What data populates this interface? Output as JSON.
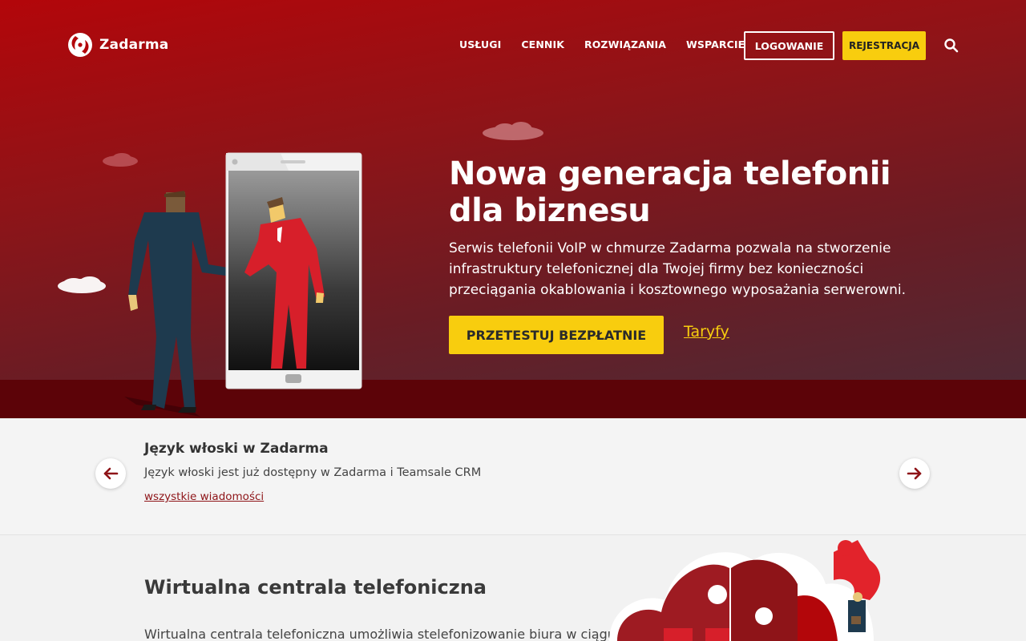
{
  "brand": {
    "name": "Zadarma"
  },
  "nav": {
    "items": [
      "USŁUGI",
      "CENNIK",
      "ROZWIĄZANIA",
      "WSPARCIE"
    ],
    "login_label": "LOGOWANIE",
    "register_label": "REJESTRACJA"
  },
  "hero": {
    "title": "Nowa generacja telefonii dla biznesu",
    "description": "Serwis telefonii VoIP w chmurze Zadarma pozwala na stworzenie infrastruktury telefonicznej dla Twojej firmy bez konieczności przeciągania okablowania i kosztownego wyposażania serwerowni.",
    "cta_label": "PRZETESTUJ BEZPŁATNIE",
    "secondary_link": "Taryfy"
  },
  "news": {
    "title": "Język włoski w Zadarma",
    "text": "Język włoski jest już dostępny w Zadarma i Teamsale CRM",
    "link": "wszystkie wiadomości"
  },
  "section": {
    "title": "Wirtualna centrala telefoniczna",
    "text": "Wirtualna centrala telefoniczna umożliwia stelefonizowanie biura w ciągu"
  },
  "colors": {
    "brand_red": "#8e1418",
    "accent_yellow": "#f8cd0e",
    "ground": "#5c0308"
  },
  "icons": {
    "search": "search-icon",
    "prev": "arrow-left-icon",
    "next": "arrow-right-icon"
  }
}
